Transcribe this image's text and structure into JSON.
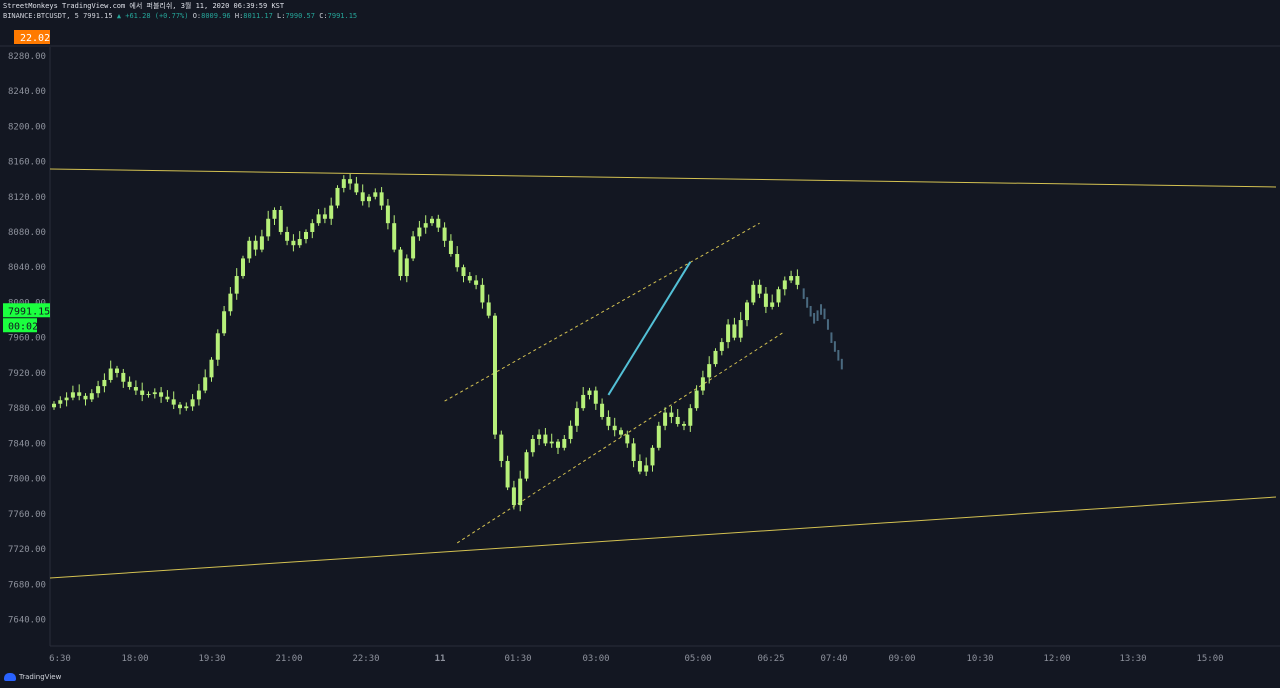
{
  "header": {
    "line1": "StreetMonkeys TradingView.com 에서 퍼블리쉬, 3월 11, 2020 06:39:59 KST",
    "symbol": "BINANCE:BTCUSDT, 5",
    "last": "7991.15",
    "change": "▲ +61.28 (+0.77%)",
    "o_label": "O:",
    "o": "8009.96",
    "h_label": "H:",
    "h": "8011.17",
    "l_label": "L:",
    "l": "7990.57",
    "c_label": "C:",
    "c": "7991.15"
  },
  "footer": {
    "brand": "TradingView"
  },
  "colors": {
    "bg": "#131722",
    "up": "#b7f07a",
    "down": "#b7f07a",
    "accent": "#1de9b6",
    "trend": "#d4c252",
    "proj": "#53c0d6"
  },
  "chart_data": {
    "type": "candlestick",
    "y_axis": {
      "ticks": [
        "8280.00",
        "8240.00",
        "8200.00",
        "8160.00",
        "8120.00",
        "8080.00",
        "8040.00",
        "8000.00",
        "7960.00",
        "7920.00",
        "7880.00",
        "7840.00",
        "7800.00",
        "7760.00",
        "7720.00",
        "7680.00",
        "7640.00"
      ],
      "min": 7610,
      "max": 8290
    },
    "x_axis": {
      "ticks": [
        "6:30",
        "18:00",
        "19:30",
        "21:00",
        "22:30",
        "11",
        "01:30",
        "03:00",
        "05:00",
        "06:25",
        "07:40",
        "09:00",
        "10:30",
        "12:00",
        "13:30",
        "15:00"
      ]
    },
    "price_label": "7991.15",
    "countdown": "00:02",
    "top_badge": "22.02",
    "trendlines": [
      {
        "name": "upper-resistance",
        "points": [
          [
            "start",
            8152
          ],
          [
            "end",
            8132
          ]
        ]
      },
      {
        "name": "lower-support",
        "points": [
          [
            "start",
            7693
          ],
          [
            "end",
            7785
          ]
        ]
      }
    ],
    "closes": [
      7885,
      7889,
      7892,
      7898,
      7894,
      7890,
      7897,
      7905,
      7912,
      7925,
      7920,
      7910,
      7904,
      7900,
      7895,
      7896,
      7898,
      7893,
      7890,
      7884,
      7880,
      7882,
      7890,
      7900,
      7915,
      7935,
      7965,
      7990,
      8010,
      8030,
      8050,
      8070,
      8060,
      8075,
      8095,
      8105,
      8080,
      8070,
      8065,
      8072,
      8080,
      8090,
      8100,
      8095,
      8110,
      8130,
      8140,
      8135,
      8125,
      8115,
      8120,
      8125,
      8110,
      8090,
      8060,
      8030,
      8050,
      8075,
      8085,
      8090,
      8095,
      8085,
      8070,
      8055,
      8040,
      8030,
      8025,
      8020,
      8000,
      7985,
      7850,
      7820,
      7790,
      7770,
      7800,
      7830,
      7845,
      7850,
      7840,
      7842,
      7835,
      7845,
      7860,
      7880,
      7895,
      7900,
      7885,
      7870,
      7860,
      7855,
      7850,
      7840,
      7820,
      7808,
      7815,
      7835,
      7860,
      7875,
      7870,
      7862,
      7860,
      7880,
      7900,
      7915,
      7930,
      7945,
      7955,
      7975,
      7960,
      7980,
      8000,
      8020,
      8010,
      7995,
      8000,
      8015,
      8025,
      8030,
      8020
    ],
    "projection_line": {
      "from": [
        88,
        7895
      ],
      "to": [
        101,
        8046
      ]
    },
    "channel": {
      "upper_from": [
        62,
        7888
      ],
      "upper_to": [
        112,
        8090
      ],
      "lower_from": [
        64,
        7727
      ],
      "lower_to": [
        116,
        7967
      ]
    },
    "tail": [
      8010,
      8000,
      7990,
      7982,
      7985,
      7992,
      7987,
      7975,
      7960,
      7950,
      7940,
      7930
    ]
  }
}
